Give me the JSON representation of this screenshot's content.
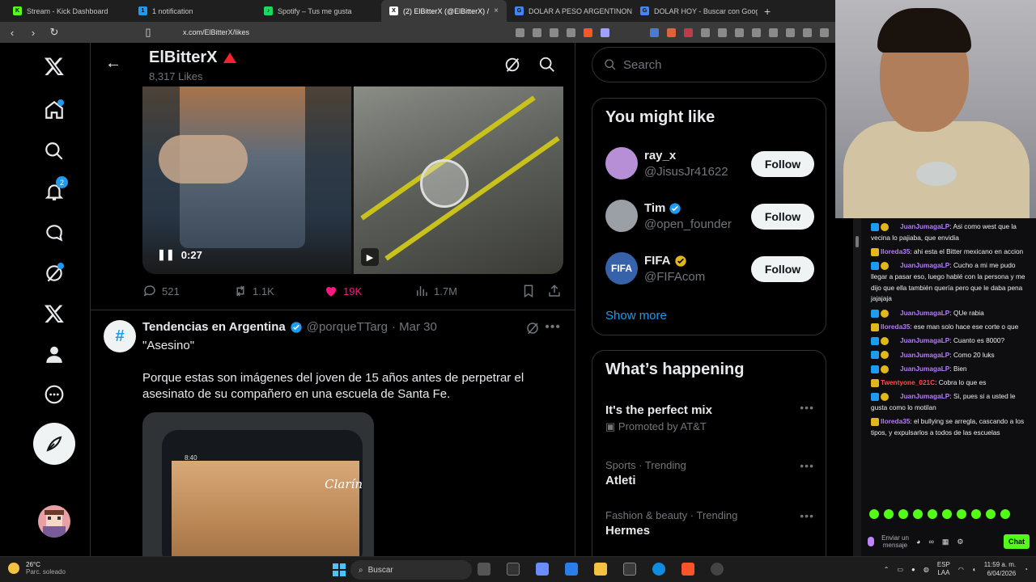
{
  "tabs": [
    {
      "label": "Stream - Kick Dashboard",
      "color": "#53fc18",
      "glyph": "K"
    },
    {
      "label": "1 notification",
      "color": "#1d9bf0",
      "glyph": "1"
    },
    {
      "label": "Spotify – Tus me gusta",
      "color": "#1ed760",
      "glyph": "♪"
    },
    {
      "label": "(2) ElBitterX (@ElBitterX) /",
      "color": "#ffffff",
      "glyph": "X",
      "active": true
    },
    {
      "label": "DOLAR A PESO ARGENTINONO - B",
      "color": "#4285f4",
      "glyph": "G"
    },
    {
      "label": "DOLAR HOY - Buscar con Google",
      "color": "#4285f4",
      "glyph": "G"
    }
  ],
  "browser": {
    "url": "x.com/ElBitterX/likes",
    "new_tab": "+",
    "tab_close": "×"
  },
  "profile": {
    "name": "ElBitterX",
    "likes_count": "8,317 Likes"
  },
  "nav": {
    "notifications_badge": "2"
  },
  "post1": {
    "video_time": "0:27",
    "replies": "521",
    "reposts": "1.1K",
    "likes": "19K",
    "views": "1.7M"
  },
  "post2": {
    "author": "Tendencias en Argentina",
    "handle": "@porqueTTarg",
    "date": "· Mar 30",
    "quote": "\"Asesino\"",
    "body": "Porque estas son imágenes del joven de 15 años antes de perpetrar el asesinato de su compañero en una escuela de Santa Fe.",
    "media_status": "8:40",
    "media_brand": "Clarín"
  },
  "search": {
    "placeholder": "Search"
  },
  "who_to_follow": {
    "title": "You might like",
    "users": [
      {
        "name": "ray_x",
        "handle": "@JisusJr41622",
        "verified": "",
        "button": "Follow"
      },
      {
        "name": "Tim",
        "handle": "@open_founder",
        "verified": "blue",
        "button": "Follow"
      },
      {
        "name": "FIFA",
        "handle": "@FIFAcom",
        "verified": "gold",
        "button": "Follow"
      }
    ],
    "show_more": "Show more"
  },
  "trends": {
    "title": "What’s happening",
    "items": [
      {
        "category": "It's the perfect mix",
        "title": "Promoted by AT&T"
      },
      {
        "category": "Sports · Trending",
        "title": "Atleti"
      },
      {
        "category": "Fashion & beauty · Trending",
        "title": "Hermes"
      }
    ]
  },
  "chat": {
    "messages": [
      {
        "user": "JuanJumagaLP",
        "color": "#b47cff",
        "text": ": Asi como west que la vecina lo pajiaba, que envidia"
      },
      {
        "user": "lloreda35",
        "color": "#b47cff",
        "text": ": ahi esta el Bitter mexicano en accion"
      },
      {
        "user": "JuanJumagaLP",
        "color": "#b47cff",
        "text": ": Cucho a mi me pudo llegar a pasar eso, luego hablé con la persona y me dijo que ella también quería pero que le daba pena jajajaja"
      },
      {
        "user": "JuanJumagaLP",
        "color": "#b47cff",
        "text": ": QUe rabia"
      },
      {
        "user": "lloreda35",
        "color": "#b47cff",
        "text": ": ese man solo hace ese corte o que"
      },
      {
        "user": "JuanJumagaLP",
        "color": "#b47cff",
        "text": ": Cuanto es 8000?"
      },
      {
        "user": "JuanJumagaLP",
        "color": "#b47cff",
        "text": ": Como 20 luks"
      },
      {
        "user": "JuanJumagaLP",
        "color": "#b47cff",
        "text": ": Bien"
      },
      {
        "user": "Twentyone_021C",
        "color": "#ff4d4d",
        "text": ": Cobra lo que es"
      },
      {
        "user": "JuanJumagaLP",
        "color": "#b47cff",
        "text": ": Si, pues si a usted le gusta como lo motilan"
      },
      {
        "user": "lloreda35",
        "color": "#b47cff",
        "text": ": el bullying se arregla, cascando a los tipos, y expulsarlos a todos de las escuelas"
      }
    ],
    "input_placeholder": "Enviar un mensaje",
    "chat_button": "Chat"
  },
  "taskbar": {
    "temp": "26°C",
    "weather": "Parc. soleado",
    "search": "Buscar",
    "lang_top": "ESP",
    "lang_bottom": "LAA",
    "time": "11:59 a. m.",
    "date": "6/04/2026"
  }
}
